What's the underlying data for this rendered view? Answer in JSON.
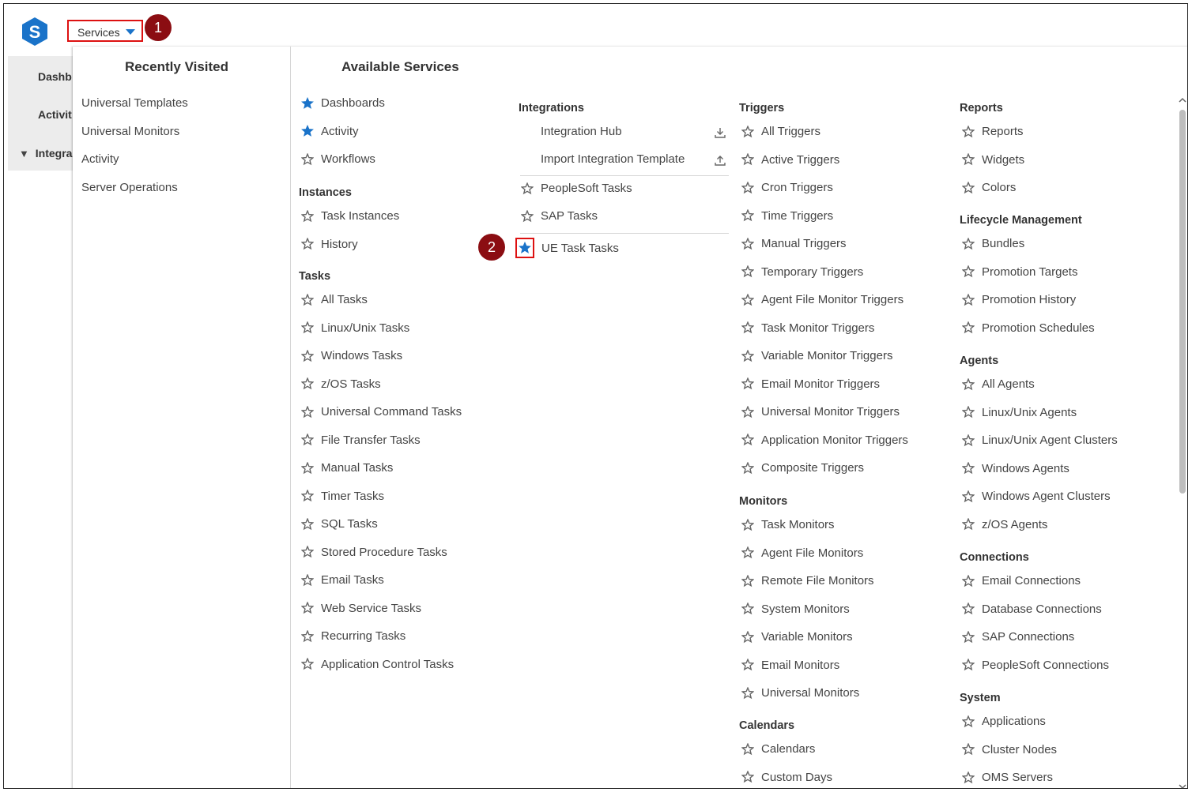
{
  "header": {
    "services_label": "Services",
    "badge1": "1",
    "badge2": "2"
  },
  "left_nav": [
    "Dashb",
    "Activit",
    "Integra"
  ],
  "recently_visited": {
    "title": "Recently Visited",
    "items": [
      "Universal Templates",
      "Universal Monitors",
      "Activity",
      "Server Operations"
    ]
  },
  "available_services": {
    "title": "Available Services",
    "col1": {
      "top": [
        "Dashboards",
        "Activity",
        "Workflows"
      ],
      "instances_title": "Instances",
      "instances": [
        "Task Instances",
        "History"
      ],
      "tasks_title": "Tasks",
      "tasks": [
        "All Tasks",
        "Linux/Unix Tasks",
        "Windows Tasks",
        "z/OS Tasks",
        "Universal Command Tasks",
        "File Transfer Tasks",
        "Manual Tasks",
        "Timer Tasks",
        "SQL Tasks",
        "Stored Procedure Tasks",
        "Email Tasks",
        "Web Service Tasks",
        "Recurring Tasks",
        "Application Control Tasks"
      ]
    },
    "col2": {
      "integrations_title": "Integrations",
      "integration_hub": "Integration Hub",
      "import_template": "Import Integration Template",
      "items": [
        "PeopleSoft Tasks",
        "SAP Tasks",
        "UE Task Tasks"
      ]
    },
    "col3": {
      "triggers_title": "Triggers",
      "triggers": [
        "All Triggers",
        "Active Triggers",
        "Cron Triggers",
        "Time Triggers",
        "Manual Triggers",
        "Temporary Triggers",
        "Agent File Monitor Triggers",
        "Task Monitor Triggers",
        "Variable Monitor Triggers",
        "Email Monitor Triggers",
        "Universal Monitor Triggers",
        "Application Monitor Triggers",
        "Composite Triggers"
      ],
      "monitors_title": "Monitors",
      "monitors": [
        "Task Monitors",
        "Agent File Monitors",
        "Remote File Monitors",
        "System Monitors",
        "Variable Monitors",
        "Email Monitors",
        "Universal Monitors"
      ],
      "calendars_title": "Calendars",
      "calendars": [
        "Calendars",
        "Custom Days"
      ]
    },
    "col4": {
      "reports_title": "Reports",
      "reports": [
        "Reports",
        "Widgets",
        "Colors"
      ],
      "lifecycle_title": "Lifecycle Management",
      "lifecycle": [
        "Bundles",
        "Promotion Targets",
        "Promotion History",
        "Promotion Schedules"
      ],
      "agents_title": "Agents",
      "agents": [
        "All Agents",
        "Linux/Unix Agents",
        "Linux/Unix Agent Clusters",
        "Windows Agents",
        "Windows Agent Clusters",
        "z/OS Agents"
      ],
      "connections_title": "Connections",
      "connections": [
        "Email Connections",
        "Database Connections",
        "SAP Connections",
        "PeopleSoft Connections"
      ],
      "system_title": "System",
      "system": [
        "Applications",
        "Cluster Nodes",
        "OMS Servers"
      ]
    }
  },
  "colors": {
    "accent": "#1a73c9",
    "highlight": "#dd1111",
    "badge": "#8b0d12"
  }
}
